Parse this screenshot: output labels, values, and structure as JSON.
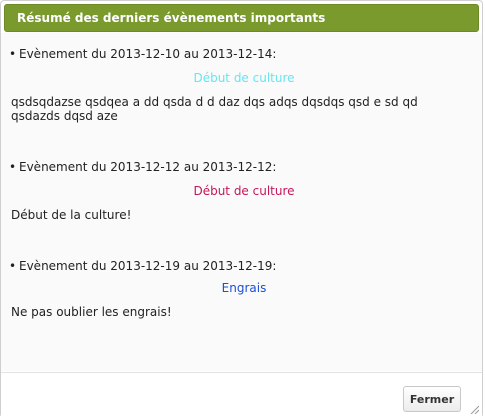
{
  "dialog": {
    "title": "Résumé des derniers évènements importants",
    "close_label": "Fermer"
  },
  "events": [
    {
      "header": "Evènement du 2013-12-10 au 2013-12-14:",
      "category": "Début de culture",
      "category_color": "#66e6f0",
      "description": "qsdsqdazse qsdqea a dd qsda d d daz dqs adqs dqsdqs qsd e sd qd qsdazds dqsd aze"
    },
    {
      "header": "Evènement du 2013-12-12 au 2013-12-12:",
      "category": "Début de culture",
      "category_color": "#c2185b",
      "description": "Début de la culture!"
    },
    {
      "header": "Evènement du 2013-12-19 au 2013-12-19:",
      "category": "Engrais",
      "category_color": "#1a4fd6",
      "description": "Ne pas oublier les engrais!"
    }
  ],
  "colors": {
    "titlebar": "#7a9a2e",
    "title_text": "#ffffff"
  }
}
